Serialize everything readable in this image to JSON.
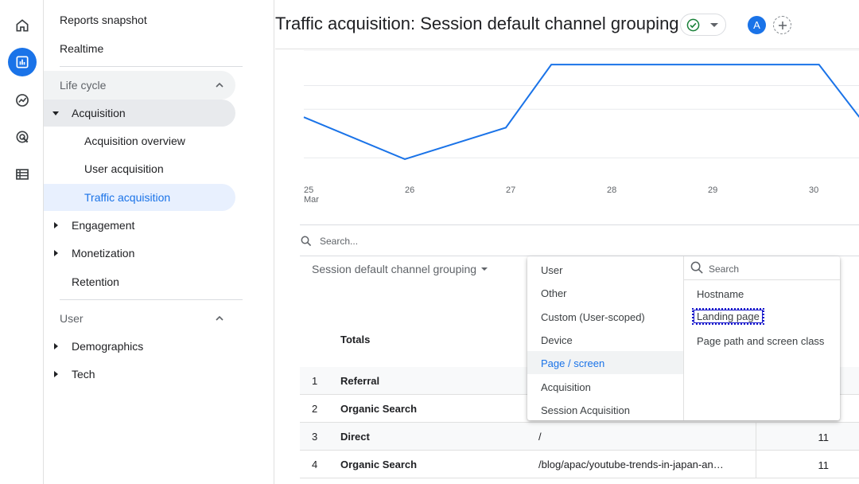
{
  "rail": {
    "icons": [
      "home-icon",
      "reports-icon",
      "explore-icon",
      "advertising-icon",
      "configure-icon"
    ]
  },
  "nav": {
    "reports_snapshot": "Reports snapshot",
    "realtime": "Realtime",
    "lifecycle_section": "Life cycle",
    "acquisition": "Acquisition",
    "acquisition_overview": "Acquisition overview",
    "user_acquisition": "User acquisition",
    "traffic_acquisition": "Traffic acquisition",
    "engagement": "Engagement",
    "monetization": "Monetization",
    "retention": "Retention",
    "user_section": "User",
    "demographics": "Demographics",
    "tech": "Tech"
  },
  "header": {
    "title": "Traffic acquisition: Session default channel grouping",
    "avatar_letter": "A"
  },
  "chart_data": {
    "type": "line",
    "x": [
      "25 Mar",
      "26",
      "27",
      "28",
      "29",
      "30"
    ],
    "x_ticks": [
      "25",
      "26",
      "27",
      "28",
      "29",
      "30"
    ],
    "x_tick_sub": "Mar",
    "series": [
      {
        "values_norm_note": "",
        "points": [
          [
            25,
            0.55
          ],
          [
            26,
            0.15
          ],
          [
            27,
            0.45
          ],
          [
            27.45,
            1.05
          ],
          [
            30.1,
            1.05
          ],
          [
            30.5,
            0.55
          ]
        ]
      }
    ],
    "grid": true
  },
  "table": {
    "search_placeholder": "Search...",
    "dimension_label": "Session default channel grouping",
    "totals_label": "Totals",
    "rows": [
      {
        "num": "1",
        "channel": "Referral",
        "page": "",
        "value": ""
      },
      {
        "num": "2",
        "channel": "Organic Search",
        "page": "",
        "value": ""
      },
      {
        "num": "3",
        "channel": "Direct",
        "page": "/",
        "value": "11"
      },
      {
        "num": "4",
        "channel": "Organic Search",
        "page": "/blog/apac/youtube-trends-in-japan-an…",
        "value": "11"
      }
    ]
  },
  "menu": {
    "categories": [
      "User",
      "Other",
      "Custom (User-scoped)",
      "Device",
      "Page / screen",
      "Acquisition",
      "Session Acquisition"
    ],
    "highlighted": "Page / screen",
    "sub_search_placeholder": "Search",
    "sub_items": [
      "Hostname",
      "Landing page",
      "Page path and screen class"
    ],
    "focused_sub_item": "Landing page"
  },
  "colors": {
    "accent": "#1a73e8",
    "selected_bg": "#e8f0fe",
    "line": "#1a73e8"
  }
}
